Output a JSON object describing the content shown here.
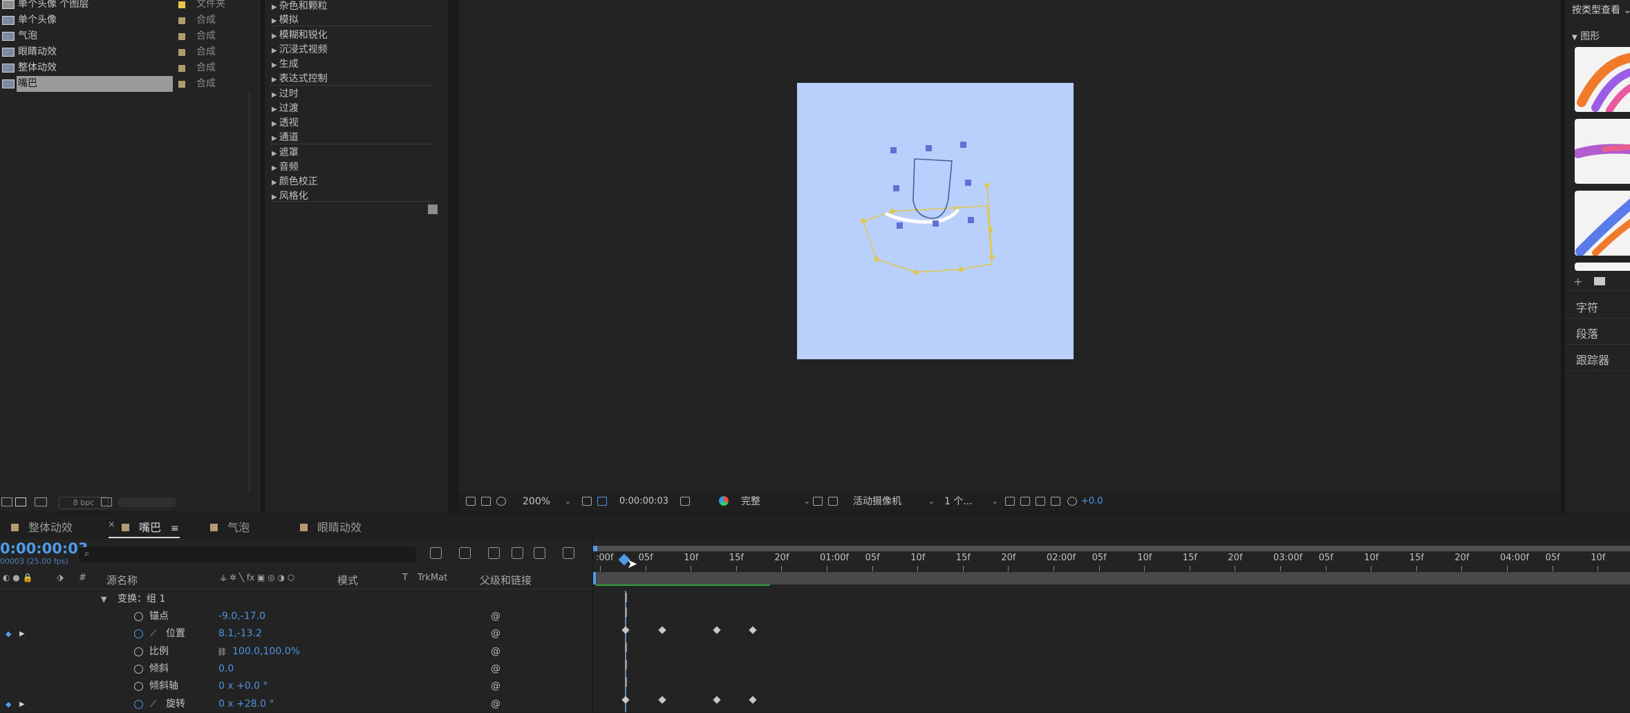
{
  "project": {
    "items": [
      {
        "name": "单个头像 个图层",
        "type": "文件夹",
        "swatch": "#e8c84a",
        "folder": true
      },
      {
        "name": "单个头像",
        "type": "合成",
        "swatch": "#b39a73"
      },
      {
        "name": "气泡",
        "type": "合成",
        "swatch": "#b39a73"
      },
      {
        "name": "眼睛动效",
        "type": "合成",
        "swatch": "#b39a73"
      },
      {
        "name": "整体动效",
        "type": "合成",
        "swatch": "#b39a73"
      },
      {
        "name": "嘴巴",
        "type": "合成",
        "swatch": "#b39a73",
        "selected": true
      }
    ],
    "bpc": "8 bpc"
  },
  "effects": {
    "categories": [
      "杂色和颗粒",
      "模拟",
      "模糊和锐化",
      "沉浸式视频",
      "生成",
      "表达式控制",
      "过时",
      "过渡",
      "透视",
      "通道",
      "遮罩",
      "音频",
      "颜色校正",
      "风格化"
    ]
  },
  "viewer": {
    "zoom": "200%",
    "timecode": "0:00:00:03",
    "resolution": "完整",
    "camera": "活动摄像机",
    "views": "1 个...",
    "exposure": "+0.0",
    "canvas_color": "#b8d0fb"
  },
  "right_panel": {
    "view_mode": "按类型查看",
    "section": "图形",
    "panels": [
      "字符",
      "段落",
      "跟踪器"
    ]
  },
  "timeline": {
    "tabs": [
      {
        "label": "整体动效",
        "swatch": "#b39a73",
        "closable": true
      },
      {
        "label": "嘴巴",
        "swatch": "#b39a73",
        "active": true
      },
      {
        "label": "气泡",
        "swatch": "#b39a73"
      },
      {
        "label": "眼睛动效",
        "swatch": "#b39a73"
      }
    ],
    "timecode": "0:00:00:03",
    "timecode_sub": "00003 (25.00 fps)",
    "columns": {
      "source_name": "源名称",
      "number": "#",
      "mode": "模式",
      "t": "T",
      "trkmat": "TrkMat",
      "parent": "父级和链接"
    },
    "group_label": "变换：组 1",
    "properties": [
      {
        "name": "锚点",
        "value": "-9.0,-17.0",
        "animated": false
      },
      {
        "name": "位置",
        "value": "8.1,-13.2",
        "animated": true
      },
      {
        "name": "比例",
        "value": "100.0,100.0%",
        "animated": false,
        "link": true
      },
      {
        "name": "倾斜",
        "value": "0.0",
        "animated": false
      },
      {
        "name": "倾斜轴",
        "value": "0 x +0.0 °",
        "animated": false
      },
      {
        "name": "旋转",
        "value": "0 x +28.0 °",
        "animated": true
      }
    ],
    "ruler_labels": [
      ":00f",
      "05f",
      "10f",
      "15f",
      "20f",
      "01:00f",
      "05f",
      "10f",
      "15f",
      "20f",
      "02:00f",
      "05f",
      "10f",
      "15f",
      "20f",
      "03:00f",
      "05f",
      "10f",
      "15f",
      "20f",
      "04:00f",
      "05f",
      "10f"
    ],
    "keyframes_frames": [
      3,
      7,
      13,
      17
    ]
  }
}
